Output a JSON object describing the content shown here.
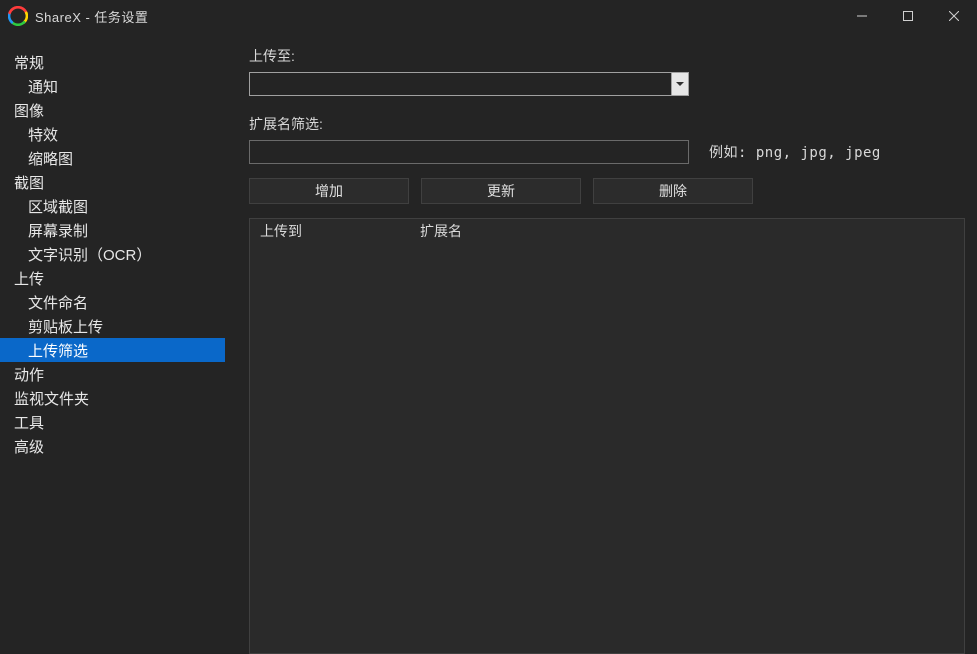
{
  "titlebar": {
    "title": "ShareX - 任务设置"
  },
  "sidebar": {
    "items": [
      {
        "label": "常规",
        "child": false,
        "selected": false
      },
      {
        "label": "通知",
        "child": true,
        "selected": false
      },
      {
        "label": "图像",
        "child": false,
        "selected": false
      },
      {
        "label": "特效",
        "child": true,
        "selected": false
      },
      {
        "label": "缩略图",
        "child": true,
        "selected": false
      },
      {
        "label": "截图",
        "child": false,
        "selected": false
      },
      {
        "label": "区域截图",
        "child": true,
        "selected": false
      },
      {
        "label": "屏幕录制",
        "child": true,
        "selected": false
      },
      {
        "label": "文字识别（OCR）",
        "child": true,
        "selected": false
      },
      {
        "label": "上传",
        "child": false,
        "selected": false
      },
      {
        "label": "文件命名",
        "child": true,
        "selected": false
      },
      {
        "label": "剪贴板上传",
        "child": true,
        "selected": false
      },
      {
        "label": "上传筛选",
        "child": true,
        "selected": true
      },
      {
        "label": "动作",
        "child": false,
        "selected": false
      },
      {
        "label": "监视文件夹",
        "child": false,
        "selected": false
      },
      {
        "label": "工具",
        "child": false,
        "selected": false
      },
      {
        "label": "高级",
        "child": false,
        "selected": false
      }
    ]
  },
  "main": {
    "upload_to_label": "上传至:",
    "upload_to_value": "",
    "ext_filter_label": "扩展名筛选:",
    "ext_filter_value": "",
    "ext_hint": "例如: png, jpg, jpeg",
    "btn_add": "增加",
    "btn_update": "更新",
    "btn_delete": "删除",
    "table": {
      "columns": [
        "上传到",
        "扩展名"
      ],
      "rows": []
    }
  }
}
